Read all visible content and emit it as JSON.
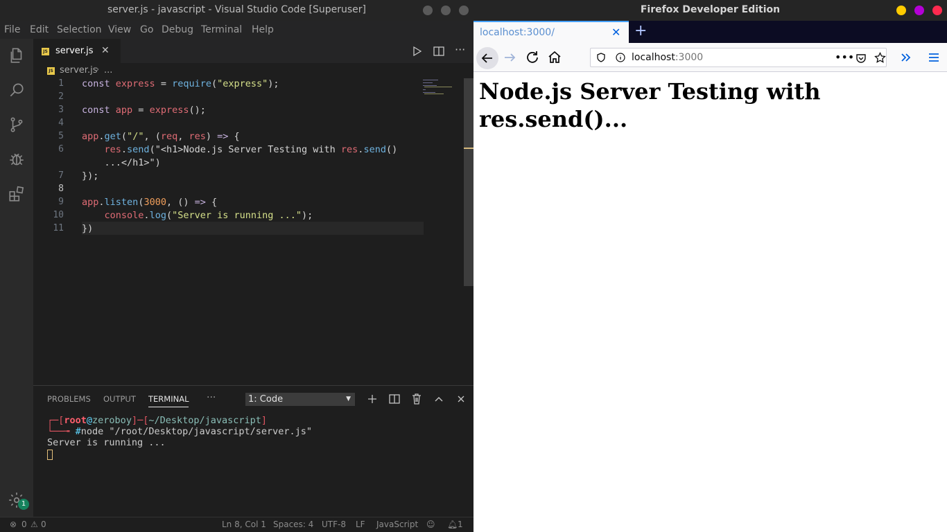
{
  "vscode": {
    "window_title": "server.js - javascript - Visual Studio Code [Superuser]",
    "menu": [
      "File",
      "Edit",
      "Selection",
      "View",
      "Go",
      "Debug",
      "Terminal",
      "Help"
    ],
    "activity_icons": [
      "files-icon",
      "search-icon",
      "source-control-icon",
      "debug-icon",
      "extensions-icon",
      "settings-gear-icon"
    ],
    "settings_badge": "1",
    "tab": {
      "label": "server.js",
      "badge": "JS"
    },
    "breadcrumb": {
      "file": "server.js",
      "separator": "›",
      "more": "..."
    },
    "code": {
      "line_numbers": [
        "1",
        "2",
        "3",
        "",
        "4",
        "5",
        "6",
        "",
        "7",
        "8",
        "9",
        "10",
        "11"
      ],
      "lines": [
        "const express = require(\"express\");",
        "",
        "const app = express();",
        "",
        "app.get(\"/\", (req, res) => {",
        "    res.send(\"<h1>Node.js Server Testing with res.send()",
        "    ...</h1>\")",
        "});",
        "",
        "app.listen(3000, () => {",
        "    console.log(\"Server is running ...\");",
        "})"
      ],
      "active_line": 8
    },
    "panel": {
      "tabs": [
        "PROBLEMS",
        "OUTPUT",
        "TERMINAL"
      ],
      "active_tab": "TERMINAL",
      "more": "···",
      "terminal_select": "1: Code"
    },
    "terminal": {
      "prompt_user": "root",
      "prompt_at": "@",
      "prompt_host": "zeroboy",
      "prompt_path": "~/Desktop/javascript",
      "prompt_hash": "#",
      "command": "node \"/root/Desktop/javascript/server.js\"",
      "output": "Server is running ..."
    },
    "status": {
      "errors": "0",
      "warnings": "0",
      "position": "Ln 8, Col 1",
      "spaces": "Spaces: 4",
      "encoding": "UTF-8",
      "eol": "LF",
      "language": "JavaScript",
      "notifications": "1"
    }
  },
  "firefox": {
    "window_title": "Firefox Developer Edition",
    "tab_label": "localhost:3000/",
    "url_host": "localhost",
    "url_port": ":3000",
    "page_heading": "Node.js Server Testing with res.send()..."
  },
  "colors": {
    "accent_tab": "#45a1ff",
    "badge": "#16825d"
  }
}
